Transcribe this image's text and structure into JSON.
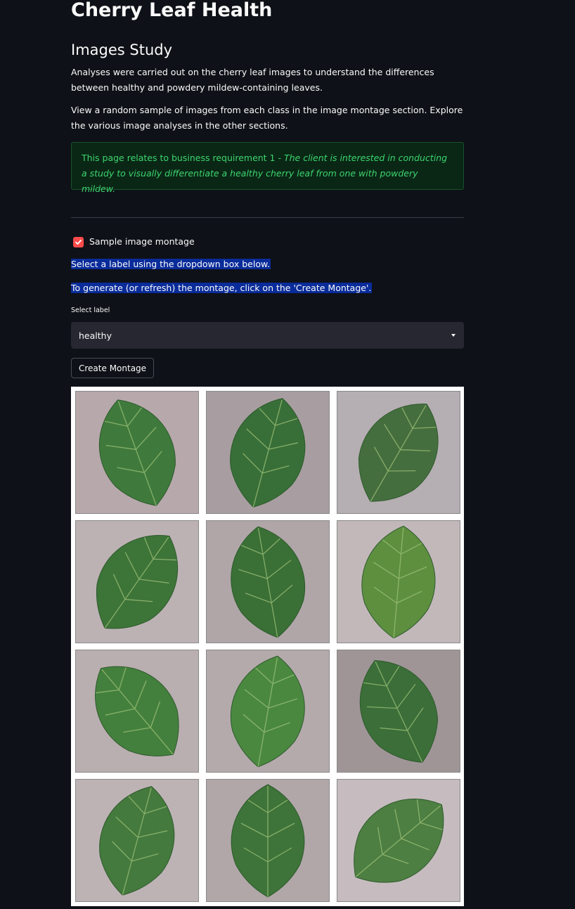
{
  "page": {
    "title": "Cherry Leaf Health",
    "section_title": "Images Study",
    "paragraph_1": "Analyses were carried out on the cherry leaf images to understand the differences between healthy and powdery mildew-containing leaves.",
    "paragraph_2": "View a random sample of images from each class in the image montage section. Explore the various image analyses in the other sections.",
    "info": {
      "prefix": "This page relates to business requirement 1 - ",
      "emphasis": "The client is interested in conducting a study to visually differentiate a healthy cherry leaf from one with powdery mildew."
    }
  },
  "montage_section": {
    "checkbox_label": "Sample image montage",
    "checkbox_checked": true,
    "instruction_1": "Select a label using the dropdown box below.",
    "instruction_2": "To generate (or refresh) the montage, click on the 'Create Montage'.",
    "select_label": "Select label",
    "select_value": "healthy",
    "button_label": "Create Montage",
    "grid": {
      "rows": 4,
      "cols": 3
    }
  },
  "colors": {
    "background": "#0e1117",
    "text": "#fafafa",
    "info_background": "#0a2716",
    "info_text": "#3dd56d",
    "checkbox_accent": "#ff4b4b",
    "highlight": "#0a2c9a",
    "select_background": "#262730",
    "leaf_green": "#3f7a3c",
    "photo_background": "#b9aeb0"
  },
  "icons": {
    "checkbox": "check-icon",
    "select": "chevron-down-icon"
  }
}
